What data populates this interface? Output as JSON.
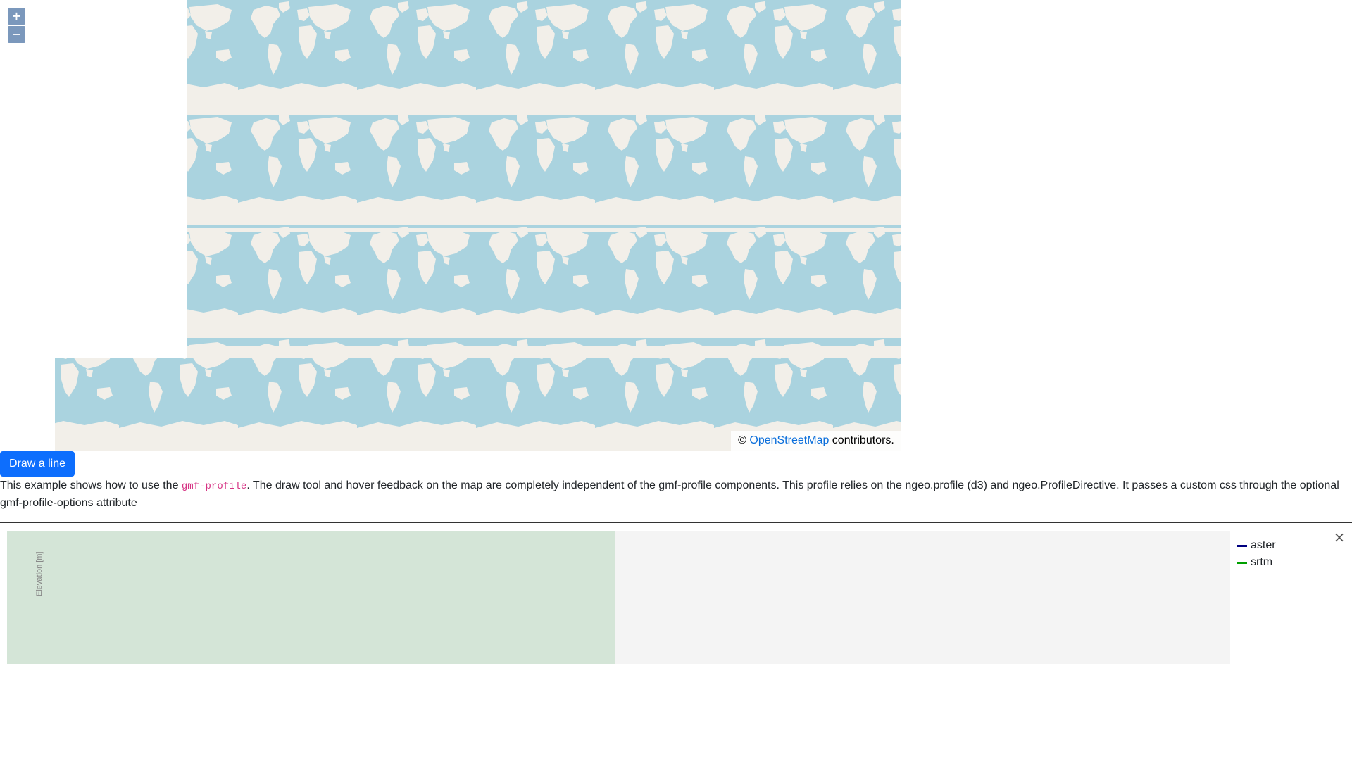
{
  "map": {
    "zoom_in_label": "+",
    "zoom_out_label": "−",
    "attribution": {
      "prefix": "©",
      "link_text": "OpenStreetMap",
      "suffix": " contributors."
    },
    "colors": {
      "water": "#aad3df",
      "land": "#f2efe9"
    }
  },
  "toolbar": {
    "draw_button_label": "Draw a line"
  },
  "description": {
    "before_code": "This example shows how to use the ",
    "code": "gmf-profile",
    "after_code": ". The draw tool and hover feedback on the map are completely independent of the gmf-profile components. This profile relies on the ngeo.profile (d3) and ngeo.ProfileDirective. It passes a custom css through the optional gmf-profile-options attribute"
  },
  "profile": {
    "y_axis_label": "Elevation [m]",
    "close_label": "×",
    "legend": [
      {
        "name": "aster",
        "color": "#000080"
      },
      {
        "name": "srtm",
        "color": "#00a000"
      }
    ],
    "colors": {
      "plot_area": "#d4e5d7",
      "panel_bg": "#f4f4f4"
    }
  }
}
